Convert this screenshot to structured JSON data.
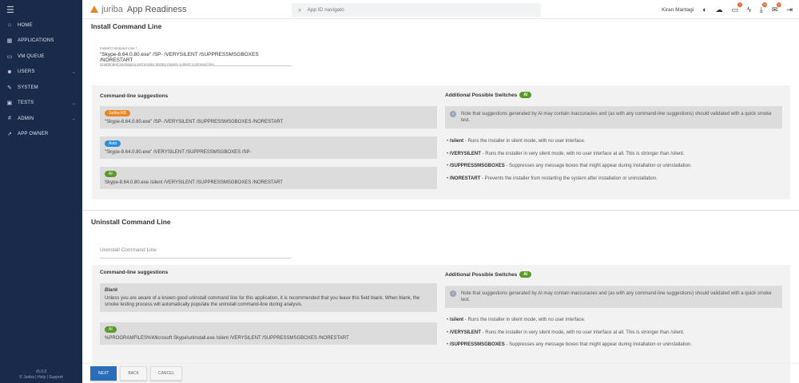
{
  "sidebar": {
    "items": [
      {
        "label": "HOME",
        "icon": "home-icon",
        "g": "⌂"
      },
      {
        "label": "APPLICATIONS",
        "icon": "grid-icon",
        "g": "▦"
      },
      {
        "label": "VM QUEUE",
        "icon": "monitor-icon",
        "g": "▭"
      },
      {
        "label": "USERS",
        "icon": "users-icon",
        "g": "☻",
        "chev": true
      },
      {
        "label": "SYSTEM",
        "icon": "wrench-icon",
        "g": "✎"
      },
      {
        "label": "TESTS",
        "icon": "tests-icon",
        "g": "▣",
        "chev": true
      },
      {
        "label": "ADMIN",
        "icon": "hash-icon",
        "g": "#",
        "chev": true
      },
      {
        "label": "APP OWNER",
        "icon": "external-link-icon",
        "g": "↗"
      }
    ],
    "version": "v5.0.0",
    "footer": "© Juriba | Help | Support"
  },
  "header": {
    "brand": "juriba",
    "app": "App Readiness",
    "search_placeholder": "App ID navigato",
    "user": "Kiran Mantagi",
    "badges": {
      "monitor": "0",
      "download": "10",
      "mail": "10"
    }
  },
  "install": {
    "title": "Install Command Line",
    "field_label": "Install Command Line *",
    "field_value": "\"Skype-8.64.0.80.exe\" /SP- /VERYSILENT /SUPPRESSMSGBOXES /NORESTART",
    "hint": "Unattended packaging and smoke testing require a silent command line",
    "suggestions_title": "Command-line suggestions",
    "suggestions": [
      {
        "tag": "Juriba KB",
        "color": "#e8862a",
        "text": "\"Skype-8.64.0.80.exe\" /SP- /VERYSILENT /SUPPRESSMSGBOXES /NORESTART"
      },
      {
        "tag": "Auto",
        "color": "#2a8fd8",
        "text": "\"Skype-8.64.0.80.exe\" /VERYSILENT /SUPPRESSMSGBOXES /SP-"
      },
      {
        "tag": "AI",
        "color": "#5a9a2a",
        "text": "Skype-8.64.0.80.exe /silent /VERYSILENT /SUPPRESSMSGBOXES /NORESTART"
      }
    ],
    "switches_title": "Additional Possible Switches",
    "switches_tag": "AI",
    "note": "Note that suggestions generated by AI may contain inaccuracies and (as with any command-line suggestions) should validated with a quick smoke test.",
    "switches": [
      {
        "name": "/silent",
        "desc": " - Runs the installer in silent mode, with no user interface."
      },
      {
        "name": "/VERYSILENT",
        "desc": " - Runs the installer in very silent mode, with no user interface at all. This is stronger than /silent."
      },
      {
        "name": "/SUPPRESSMSGBOXES",
        "desc": " - Suppresses any message boxes that might appear during installation or uninstallation."
      },
      {
        "name": "/NORESTART",
        "desc": " - Prevents the installer from restarting the system after installation or uninstallation."
      }
    ]
  },
  "uninstall": {
    "title": "Uninstall Command Line",
    "placeholder": "Uninstall Command Line",
    "suggestions_title": "Command-line suggestions",
    "blank_title": "Blank",
    "blank_text": "Unless you are aware of a known good uninstall command line for this application, it is recommended that you leave this field blank. When blank, the smoke testing process will automatically populate the uninstall command-line during analysis.",
    "ai_tag": "AI",
    "ai_text": "%PROGRAMFILES%\\Microsoft Skype\\uninstall.exe /silent /VERYSILENT /SUPPRESSMSGBOXES /NORESTART",
    "switches_title": "Additional Possible Switches",
    "switches_tag": "AI",
    "note": "Note that suggestions generated by AI may contain inaccuracies and (as with any command-line suggestions) should validated with a quick smoke test.",
    "switches": [
      {
        "name": "/silent",
        "desc": " - Runs the installer in silent mode, with no user interface."
      },
      {
        "name": "/VERYSILENT",
        "desc": " - Runs the installer in very silent mode, with no user interface at all. This is stronger than /silent."
      },
      {
        "name": "/SUPPRESSMSGBOXES",
        "desc": " - Suppresses any message boxes that might appear during installation or uninstallation."
      }
    ]
  },
  "footer": {
    "next": "NEXT",
    "back": "BACK",
    "cancel": "CANCEL"
  }
}
